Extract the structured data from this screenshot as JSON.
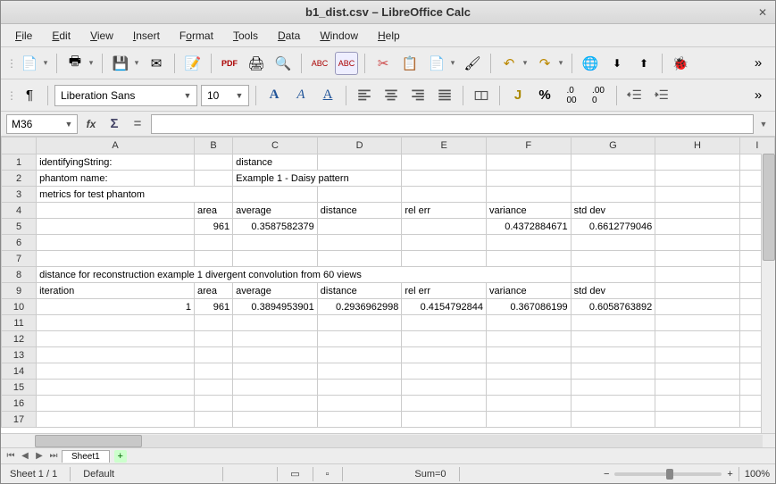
{
  "window": {
    "title": "b1_dist.csv – LibreOffice Calc"
  },
  "menu": {
    "file": "File",
    "edit": "Edit",
    "view": "View",
    "insert": "Insert",
    "format": "Format",
    "tools": "Tools",
    "data": "Data",
    "window": "Window",
    "help": "Help"
  },
  "font": {
    "name": "Liberation Sans",
    "size": "10"
  },
  "namebox": {
    "value": "M36"
  },
  "formula": {
    "value": ""
  },
  "columns": [
    "A",
    "B",
    "C",
    "D",
    "E",
    "F",
    "G",
    "H",
    "I"
  ],
  "rows_shown": 17,
  "cells": {
    "r1": {
      "A": "identifyingString:",
      "C": "distance"
    },
    "r2": {
      "A": "phantom name:",
      "C": "Example 1 - Daisy pattern"
    },
    "r3": {
      "A": "metrics for test phantom"
    },
    "r4": {
      "B": "area",
      "C": "average",
      "D": "distance",
      "E": "rel err",
      "F": "variance",
      "G": "std dev"
    },
    "r5": {
      "B": "961",
      "C": "0.3587582379",
      "F": "0.4372884671",
      "G": "0.6612779046"
    },
    "r8": {
      "A": "distance for reconstruction example 1 divergent convolution from 60 views"
    },
    "r9": {
      "A": "iteration",
      "B": "area",
      "C": "average",
      "D": "distance",
      "E": "rel err",
      "F": "variance",
      "G": "std dev"
    },
    "r10": {
      "A": "1",
      "B": "961",
      "C": "0.3894953901",
      "D": "0.2936962998",
      "E": "0.4154792844",
      "F": "0.367086199",
      "G": "0.6058763892"
    }
  },
  "tabs": {
    "sheet1": "Sheet1"
  },
  "status": {
    "sheet": "Sheet 1 / 1",
    "style": "Default",
    "sum": "Sum=0",
    "zoom": "100%"
  },
  "chart_data": {
    "type": "table",
    "title": "b1_dist.csv",
    "sections": [
      {
        "header": {
          "identifyingString": "distance",
          "phantom_name": "Example 1 - Daisy pattern"
        }
      },
      {
        "name": "metrics for test phantom",
        "columns": [
          "area",
          "average",
          "distance",
          "rel err",
          "variance",
          "std dev"
        ],
        "rows": [
          {
            "area": 961,
            "average": 0.3587582379,
            "distance": null,
            "rel err": null,
            "variance": 0.4372884671,
            "std dev": 0.6612779046
          }
        ]
      },
      {
        "name": "distance for reconstruction example 1 divergent convolution from 60 views",
        "columns": [
          "iteration",
          "area",
          "average",
          "distance",
          "rel err",
          "variance",
          "std dev"
        ],
        "rows": [
          {
            "iteration": 1,
            "area": 961,
            "average": 0.3894953901,
            "distance": 0.2936962998,
            "rel err": 0.4154792844,
            "variance": 0.367086199,
            "std dev": 0.6058763892
          }
        ]
      }
    ]
  }
}
